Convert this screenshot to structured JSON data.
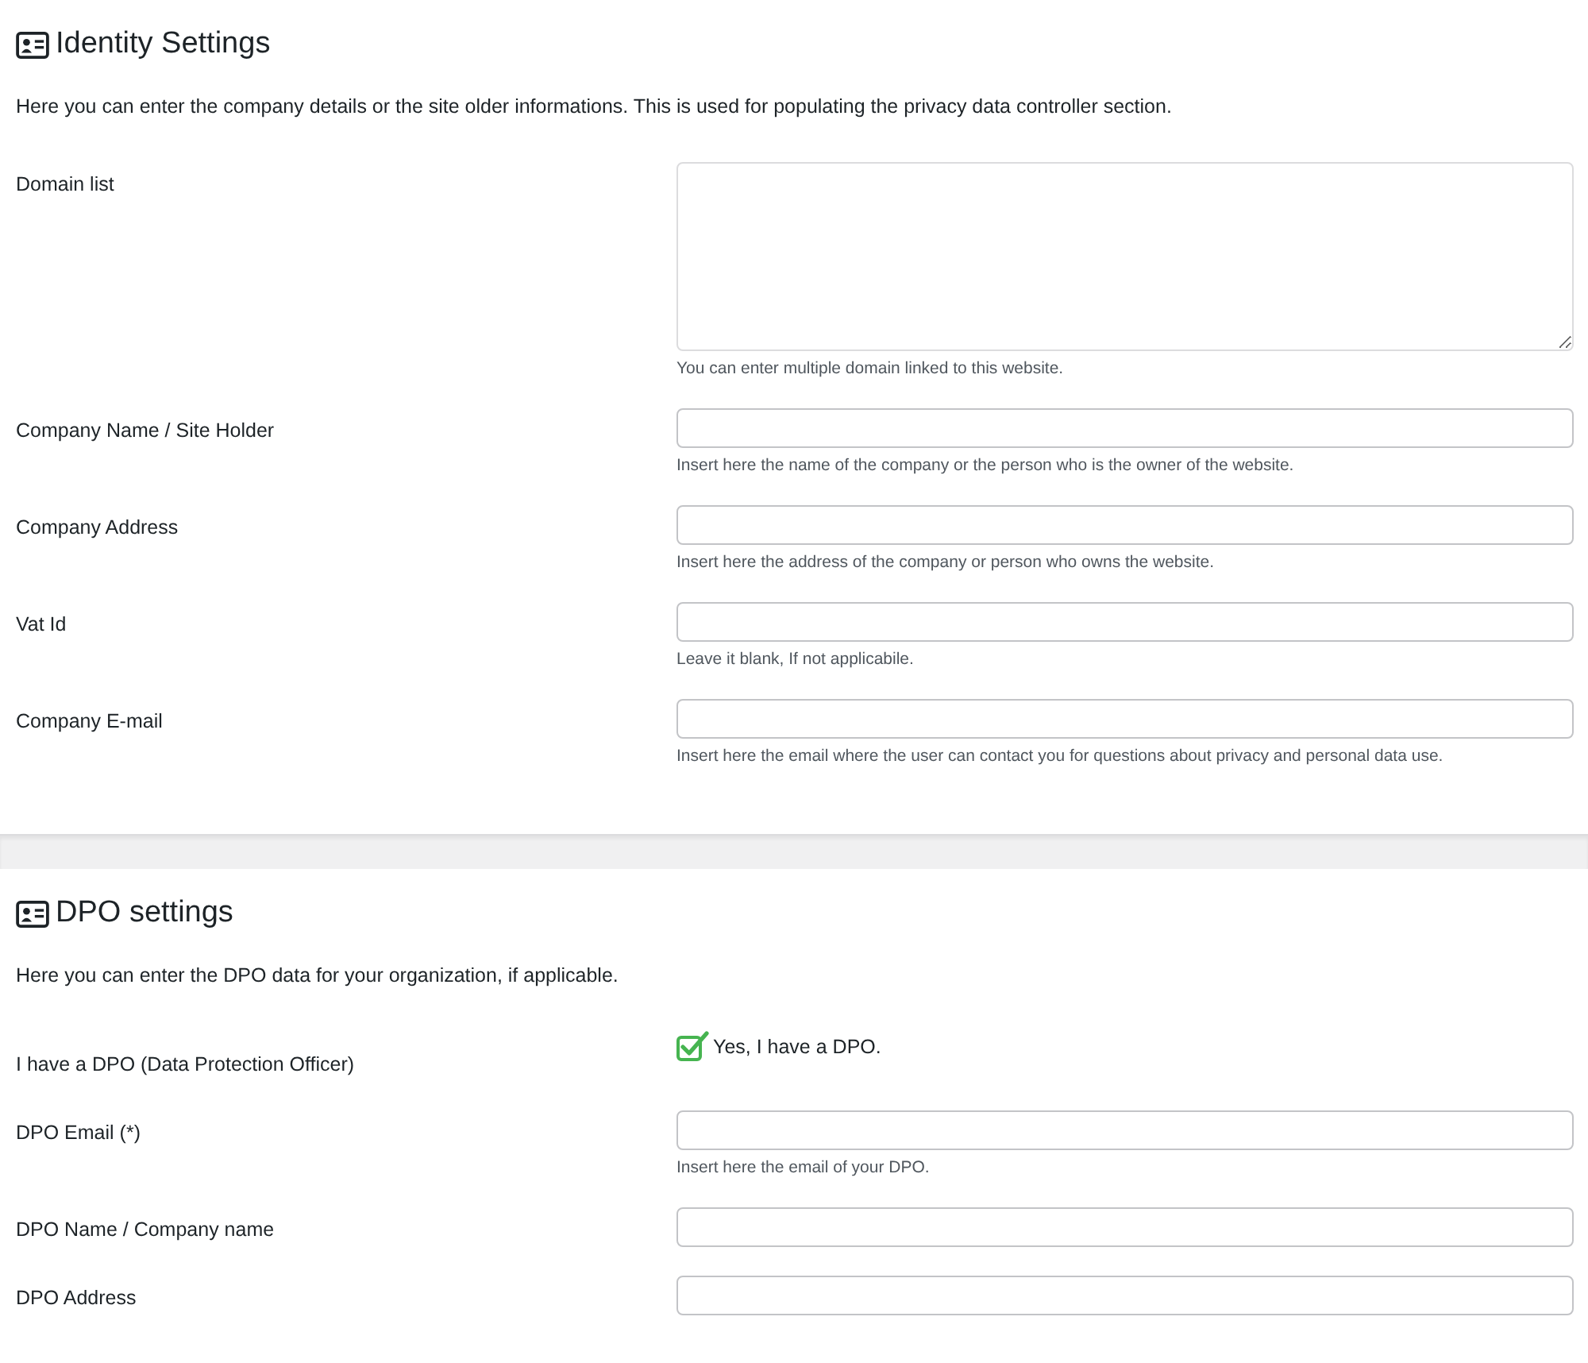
{
  "sections": [
    {
      "title": "Identity Settings",
      "description": "Here you can enter the company details or the site older informations. This is used for populating the privacy data controller section.",
      "fields": [
        {
          "kind": "textarea",
          "label": "Domain list",
          "hint": "You can enter multiple domain linked to this website."
        },
        {
          "kind": "text",
          "label": "Company Name / Site Holder",
          "hint": "Insert here the name of the company or the person who is the owner of the website."
        },
        {
          "kind": "text",
          "label": "Company Address",
          "hint": "Insert here the address of the company or person who owns the website."
        },
        {
          "kind": "text",
          "label": "Vat Id",
          "hint": "Leave it blank, If not applicabile."
        },
        {
          "kind": "text",
          "label": "Company E-mail",
          "hint": "Insert here the email where the user can contact you for questions about privacy and personal data use."
        }
      ]
    },
    {
      "title": "DPO settings",
      "description": "Here you can enter the DPO data for your organization, if applicable.",
      "fields": [
        {
          "kind": "checkbox",
          "label": "I have a DPO (Data Protection Officer)",
          "option": "Yes, I have a DPO.",
          "checked": true
        },
        {
          "kind": "text",
          "label": "DPO Email (*)",
          "hint": "Insert here the email of your DPO."
        },
        {
          "kind": "text",
          "label": "DPO Name / Company name"
        },
        {
          "kind": "text",
          "label": "DPO Address"
        }
      ]
    }
  ]
}
